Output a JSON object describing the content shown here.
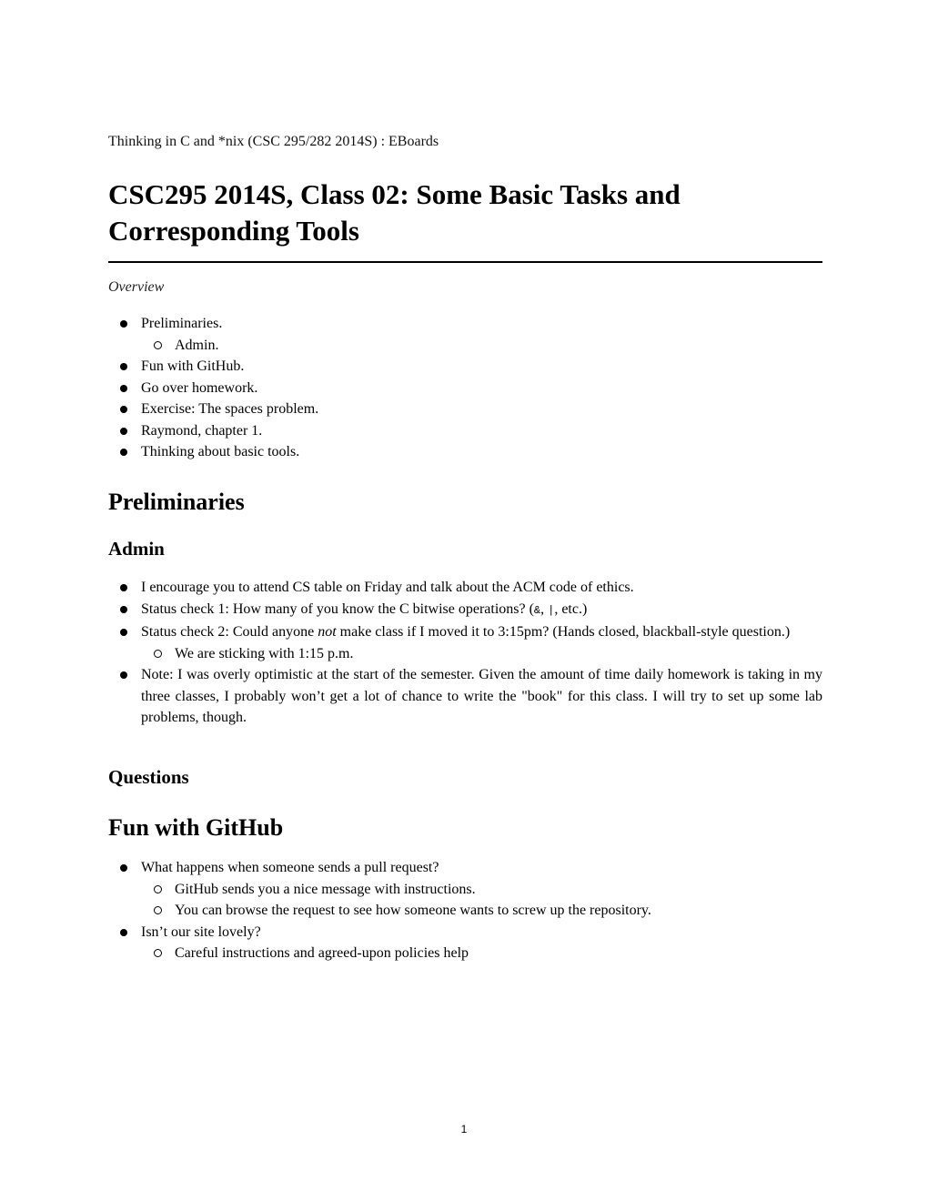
{
  "header": {
    "breadcrumb": "Thinking in C and *nix (CSC 295/282 2014S) : EBoards"
  },
  "title": "CSC295 2014S, Class 02: Some Basic Tasks and Corresponding Tools",
  "overview": {
    "label": "Overview",
    "items": [
      {
        "text": "Preliminaries.",
        "children": [
          "Admin."
        ]
      },
      {
        "text": "Fun with GitHub."
      },
      {
        "text": "Go over homework."
      },
      {
        "text": "Exercise: The spaces problem."
      },
      {
        "text": "Raymond, chapter 1."
      },
      {
        "text": "Thinking about basic tools."
      }
    ]
  },
  "sections": {
    "preliminaries": {
      "heading": "Preliminaries",
      "admin": {
        "heading": "Admin",
        "items": [
          {
            "text": "I encourage you to attend CS table on Friday and talk about the ACM code of ethics."
          },
          {
            "text_before": "Status check 1: How many of you know the C bitwise operations? (",
            "code1": "&",
            "sep": ", ",
            "code2": "|",
            "text_after": ", etc.)"
          },
          {
            "text_before": "Status check 2: Could anyone ",
            "emphasis": "not",
            "text_after": " make class if I moved it to 3:15pm? (Hands closed, blackball-style question.)",
            "children": [
              "We are sticking with 1:15 p.m."
            ]
          },
          {
            "text": "Note: I was overly optimistic at the start of the semester. Given the amount of time daily homework is taking in my three classes, I probably won’t get a lot of chance to write the \"book\" for this class. I will try to set up some lab problems, though."
          }
        ]
      },
      "questions": {
        "heading": "Questions"
      }
    },
    "github": {
      "heading": "Fun with GitHub",
      "items": [
        {
          "text": "What happens when someone sends a pull request?",
          "children": [
            "GitHub sends you a nice message with instructions.",
            "You can browse the request to see how someone wants to screw up the repository."
          ]
        },
        {
          "text": "Isn’t our site lovely?",
          "children": [
            "Careful instructions and agreed-upon policies help"
          ]
        }
      ]
    }
  },
  "footer": {
    "page_number": "1"
  }
}
